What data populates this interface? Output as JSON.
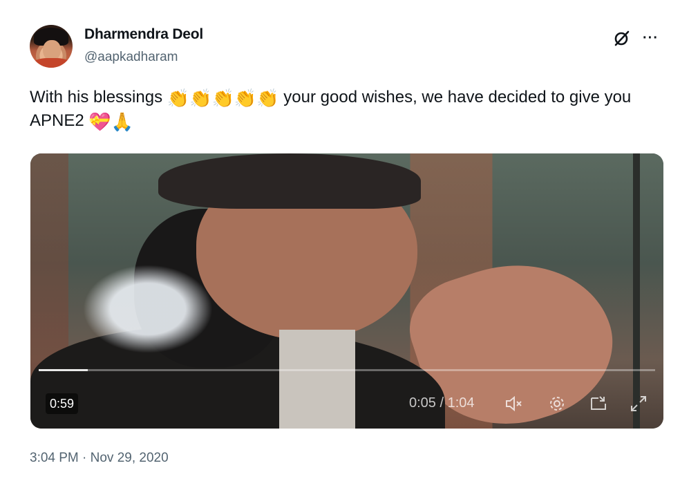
{
  "author": {
    "display_name": "Dharmendra Deol",
    "handle": "@aapkadharam",
    "avatar_icon": "avatar-photo"
  },
  "actions": {
    "grok_icon": "grok-icon",
    "more_label": "···"
  },
  "tweet": {
    "text_part1": "With his blessings",
    "clap_emojis": [
      "👏",
      "👏",
      "👏",
      "👏",
      "👏"
    ],
    "text_part2": "your good wishes, we have decided to give you APNE2",
    "heart_emoji": "💝",
    "pray_emoji": "🙏"
  },
  "video": {
    "duration_badge": "0:59",
    "time_readout": "0:05 / 1:04",
    "progress_fraction": 0.08,
    "controls": [
      "mute-icon",
      "settings-icon",
      "picture-in-picture-icon",
      "fullscreen-icon"
    ]
  },
  "timestamp": "3:04 PM · Nov 29, 2020",
  "colors": {
    "text_primary": "#0f1419",
    "text_secondary": "#536471"
  }
}
